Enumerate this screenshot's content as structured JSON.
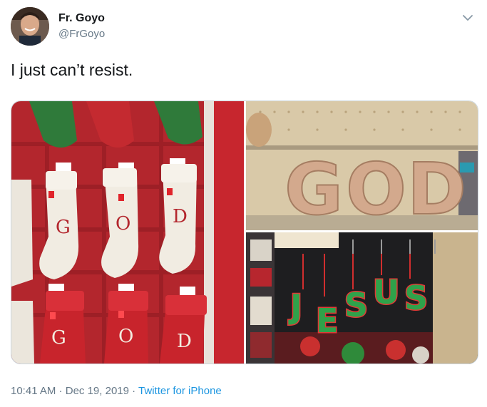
{
  "author": {
    "name": "Fr. Goyo",
    "handle": "@FrGoyo"
  },
  "tweet": {
    "text": "I just can’t resist."
  },
  "photos": {
    "stockings": {
      "top_letters": [
        "G",
        "O",
        "D"
      ],
      "bottom_letters": [
        "G",
        "O",
        "D"
      ]
    },
    "box_letters": [
      "G",
      "O",
      "D"
    ],
    "ornament_letters": [
      "J",
      "E",
      "S",
      "U",
      "S"
    ]
  },
  "footer": {
    "time": "10:41 AM",
    "sep1": " · ",
    "date": "Dec 19, 2019",
    "sep2": " · ",
    "source": "Twitter for iPhone"
  },
  "colors": {
    "link": "#1b95e0",
    "secondary_text": "#657786"
  },
  "icons": {
    "menu": "chevron-down-icon"
  }
}
